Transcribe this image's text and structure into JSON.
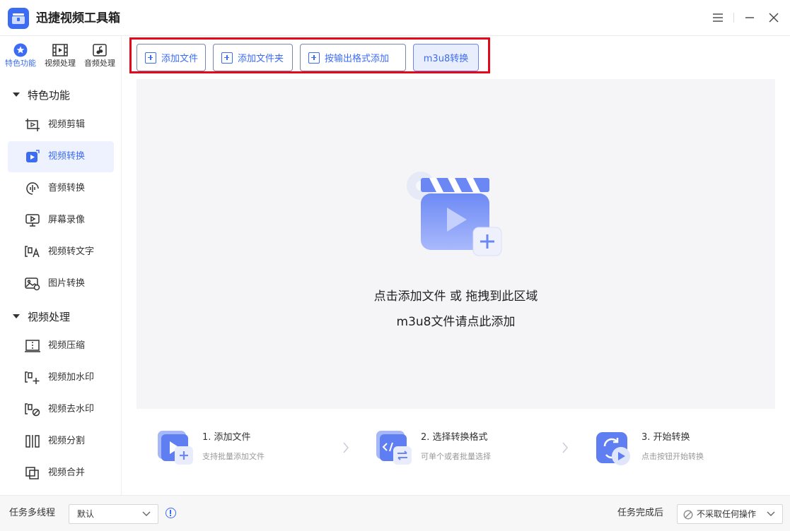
{
  "app": {
    "title": "迅捷视频工具箱"
  },
  "mode_tabs": [
    {
      "label": "特色功能",
      "icon": "star-icon",
      "active": true
    },
    {
      "label": "视频处理",
      "icon": "film-icon",
      "active": false
    },
    {
      "label": "音频处理",
      "icon": "music-note-icon",
      "active": false
    }
  ],
  "sidebar": {
    "sections": [
      {
        "label": "特色功能"
      },
      {
        "label": "视频处理"
      }
    ],
    "feature_items": [
      {
        "label": "视频剪辑",
        "icon": "crop-icon"
      },
      {
        "label": "视频转换",
        "icon": "video-convert-icon",
        "active": true
      },
      {
        "label": "音频转换",
        "icon": "audio-wave-icon"
      },
      {
        "label": "屏幕录像",
        "icon": "screen-record-icon"
      },
      {
        "label": "视频转文字",
        "icon": "video-to-text-icon"
      },
      {
        "label": "图片转换",
        "icon": "image-icon"
      }
    ],
    "video_items": [
      {
        "label": "视频压缩",
        "icon": "compress-icon"
      },
      {
        "label": "视频加水印",
        "icon": "add-watermark-icon"
      },
      {
        "label": "视频去水印",
        "icon": "remove-watermark-icon"
      },
      {
        "label": "视频分割",
        "icon": "split-icon"
      },
      {
        "label": "视频合并",
        "icon": "merge-icon"
      }
    ]
  },
  "toolbar": {
    "add_file": "添加文件",
    "add_folder": "添加文件夹",
    "add_by_format": "按输出格式添加",
    "m3u8_convert": "m3u8转换",
    "accent": "#3d6cf4",
    "highlight_border": "#e3081a"
  },
  "dropzone": {
    "line1": "点击添加文件 或 拖拽到此区域",
    "line2": "m3u8文件请点此添加"
  },
  "steps": [
    {
      "title": "1. 添加文件",
      "desc": "支持批量添加文件",
      "icon": "add-file-step-icon"
    },
    {
      "title": "2. 选择转换格式",
      "desc": "可单个或者批量选择",
      "icon": "format-step-icon"
    },
    {
      "title": "3. 开始转换",
      "desc": "点击按钮开始转换",
      "icon": "convert-step-icon"
    }
  ],
  "footer": {
    "multithread_label": "任务多线程",
    "multithread_value": "默认",
    "after_label": "任务完成后",
    "after_value": "不采取任何操作"
  }
}
